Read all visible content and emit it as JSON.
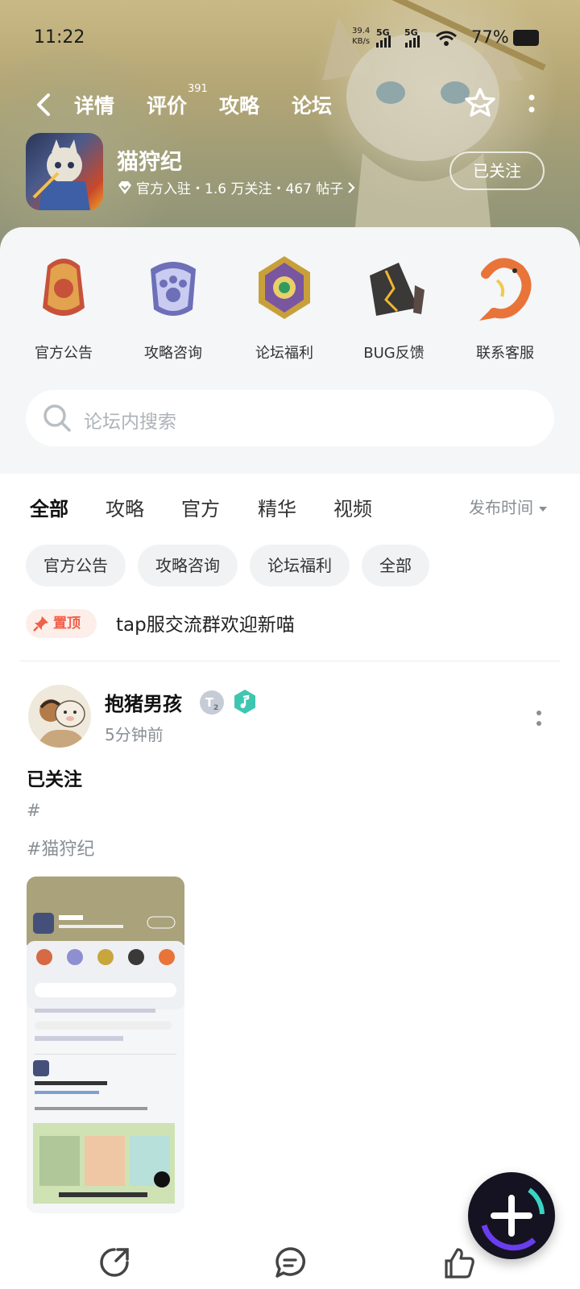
{
  "status_bar": {
    "time": "11:22",
    "speed_value": "39.4",
    "speed_unit": "KB/s",
    "sig1": "5G",
    "sig2": "5G",
    "battery": "77%"
  },
  "nav": {
    "tabs": [
      {
        "label": "详情"
      },
      {
        "label": "评价",
        "badge": "391"
      },
      {
        "label": "攻略"
      },
      {
        "label": "论坛"
      }
    ],
    "active_tab": "论坛"
  },
  "game": {
    "name": "猫狩纪",
    "meta": "官方入驻・1.6 万关注・467 帖子",
    "follow_label": "已关注"
  },
  "categories": [
    {
      "label": "官方公告",
      "icon": "bell-badge-icon"
    },
    {
      "label": "攻略咨询",
      "icon": "paw-badge-icon"
    },
    {
      "label": "论坛福利",
      "icon": "jade-gem-icon"
    },
    {
      "label": "BUG反馈",
      "icon": "cracked-stone-icon"
    },
    {
      "label": "联系客服",
      "icon": "koi-fish-icon"
    }
  ],
  "search": {
    "placeholder": "论坛内搜索"
  },
  "filter_tabs": [
    {
      "label": "全部"
    },
    {
      "label": "攻略"
    },
    {
      "label": "官方"
    },
    {
      "label": "精华"
    },
    {
      "label": "视频"
    }
  ],
  "filter_active": "全部",
  "sort_label": "发布时间",
  "chips": [
    "官方公告",
    "攻略咨询",
    "论坛福利",
    "全部"
  ],
  "pinned": {
    "badge": "置顶",
    "text": "tap服交流群欢迎新喵"
  },
  "post": {
    "author": "抱猪男孩",
    "level": "T",
    "level_num": "2",
    "time": "5分钟前",
    "title": "已关注",
    "tag1": "#",
    "tag2": "#猫狩纪"
  },
  "colors": {
    "accent": "#19d3c5",
    "pin": "#f0604a",
    "fab": "#151321"
  }
}
